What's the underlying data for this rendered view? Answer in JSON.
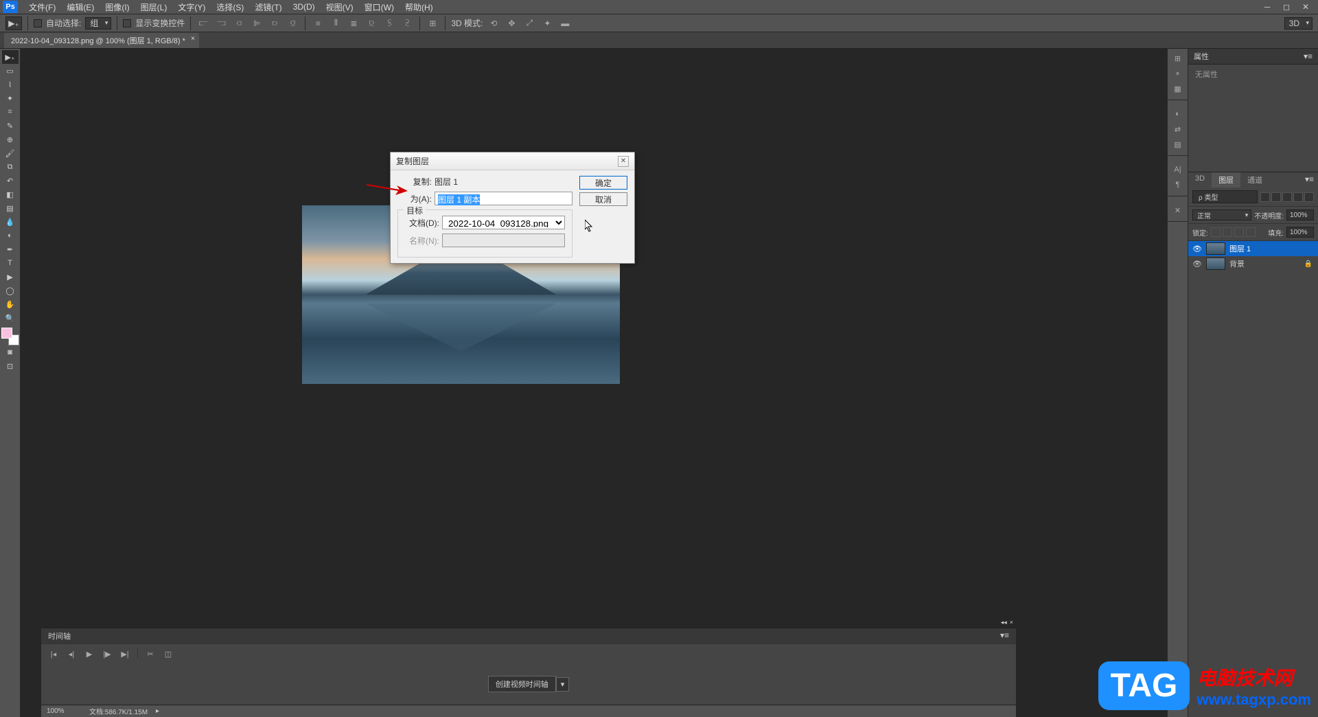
{
  "app": {
    "logo": "Ps"
  },
  "menu": {
    "items": [
      "文件(F)",
      "编辑(E)",
      "图像(I)",
      "图层(L)",
      "文字(Y)",
      "选择(S)",
      "滤镜(T)",
      "3D(D)",
      "视图(V)",
      "窗口(W)",
      "帮助(H)"
    ]
  },
  "options_bar": {
    "auto_select_label": "自动选择:",
    "auto_select_value": "组",
    "show_transform_label": "显示变换控件",
    "mode_3d_label": "3D 模式:",
    "right_dd": "3D"
  },
  "document": {
    "tab_title": "2022-10-04_093128.png @ 100% (图层 1, RGB/8) *"
  },
  "properties_panel": {
    "title": "属性",
    "content": "无属性"
  },
  "layers_panel": {
    "tabs": [
      "3D",
      "图层",
      "通道"
    ],
    "filter_label": "ρ 类型",
    "blend_mode": "正常",
    "opacity_label": "不透明度:",
    "opacity_value": "100%",
    "lock_label": "锁定:",
    "fill_label": "填充:",
    "fill_value": "100%",
    "layers": [
      {
        "name": "图层 1",
        "selected": true,
        "locked": false
      },
      {
        "name": "背景",
        "selected": false,
        "locked": true
      }
    ]
  },
  "timeline_panel": {
    "title": "时间轴",
    "create_button": "创建视频时间轴"
  },
  "status_bar": {
    "zoom": "100%",
    "doc_info": "文档:586.7K/1.15M"
  },
  "dialog": {
    "title": "复制图层",
    "copy_label": "复制:",
    "copy_value": "图层 1",
    "as_label": "为(A):",
    "as_value": "图层 1 副本",
    "target_legend": "目标",
    "doc_label": "文档(D):",
    "doc_value": "2022-10-04_093128.png",
    "name_label": "名称(N):",
    "ok_btn": "确定",
    "cancel_btn": "取消"
  },
  "watermark": {
    "badge": "TAG",
    "cn": "电脑技术网",
    "url": "www.tagxp.com"
  }
}
